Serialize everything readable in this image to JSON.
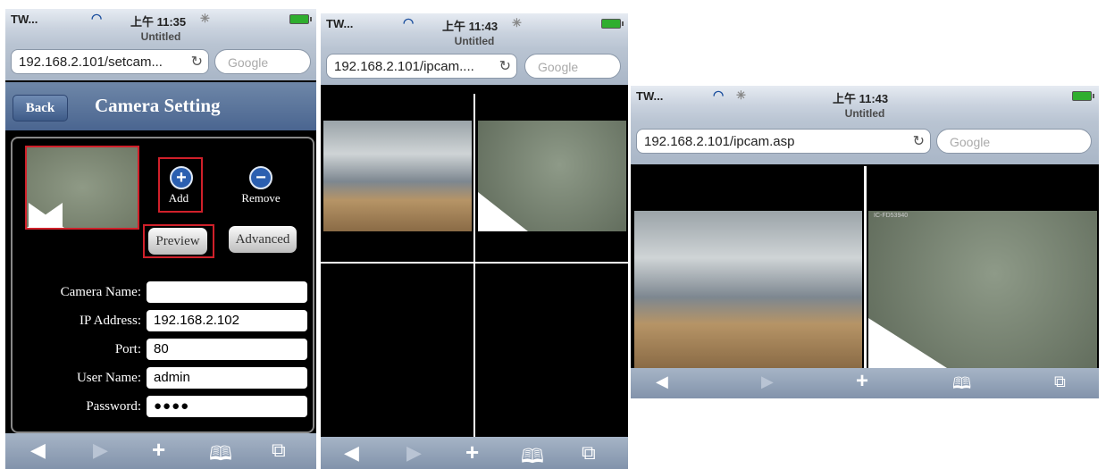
{
  "phone1": {
    "status": {
      "carrier": "TW...",
      "time": "上午 11:35"
    },
    "page_title": "Untitled",
    "url": "192.168.2.101/setcam...",
    "search_placeholder": "Google",
    "nav": {
      "back": "Back",
      "title": "Camera Setting"
    },
    "buttons": {
      "add": "Add",
      "remove": "Remove",
      "preview": "Preview",
      "advanced": "Advanced"
    },
    "fields": [
      {
        "label": "Camera Name:",
        "value": ""
      },
      {
        "label": "IP Address:",
        "value": "192.168.2.102"
      },
      {
        "label": "Port:",
        "value": "80"
      },
      {
        "label": "User Name:",
        "value": "admin"
      },
      {
        "label": "Password:",
        "value": "●●●●"
      }
    ]
  },
  "phone2": {
    "status": {
      "carrier": "TW...",
      "time": "上午 11:43"
    },
    "page_title": "Untitled",
    "url": "192.168.2.101/ipcam....",
    "search_placeholder": "Google"
  },
  "phone3": {
    "status": {
      "carrier": "TW...",
      "time": "上午 11:43"
    },
    "page_title": "Untitled",
    "url": "192.168.2.101/ipcam.asp",
    "search_placeholder": "Google",
    "camera_tag": "IC-FD53940"
  },
  "toolbar_icons": [
    "back-icon",
    "forward-icon",
    "add-icon",
    "bookmarks-icon",
    "pages-icon"
  ],
  "colors": {
    "highlight": "#d0202a",
    "nav_blue": "#4a6590",
    "battery": "#2fae2f"
  }
}
